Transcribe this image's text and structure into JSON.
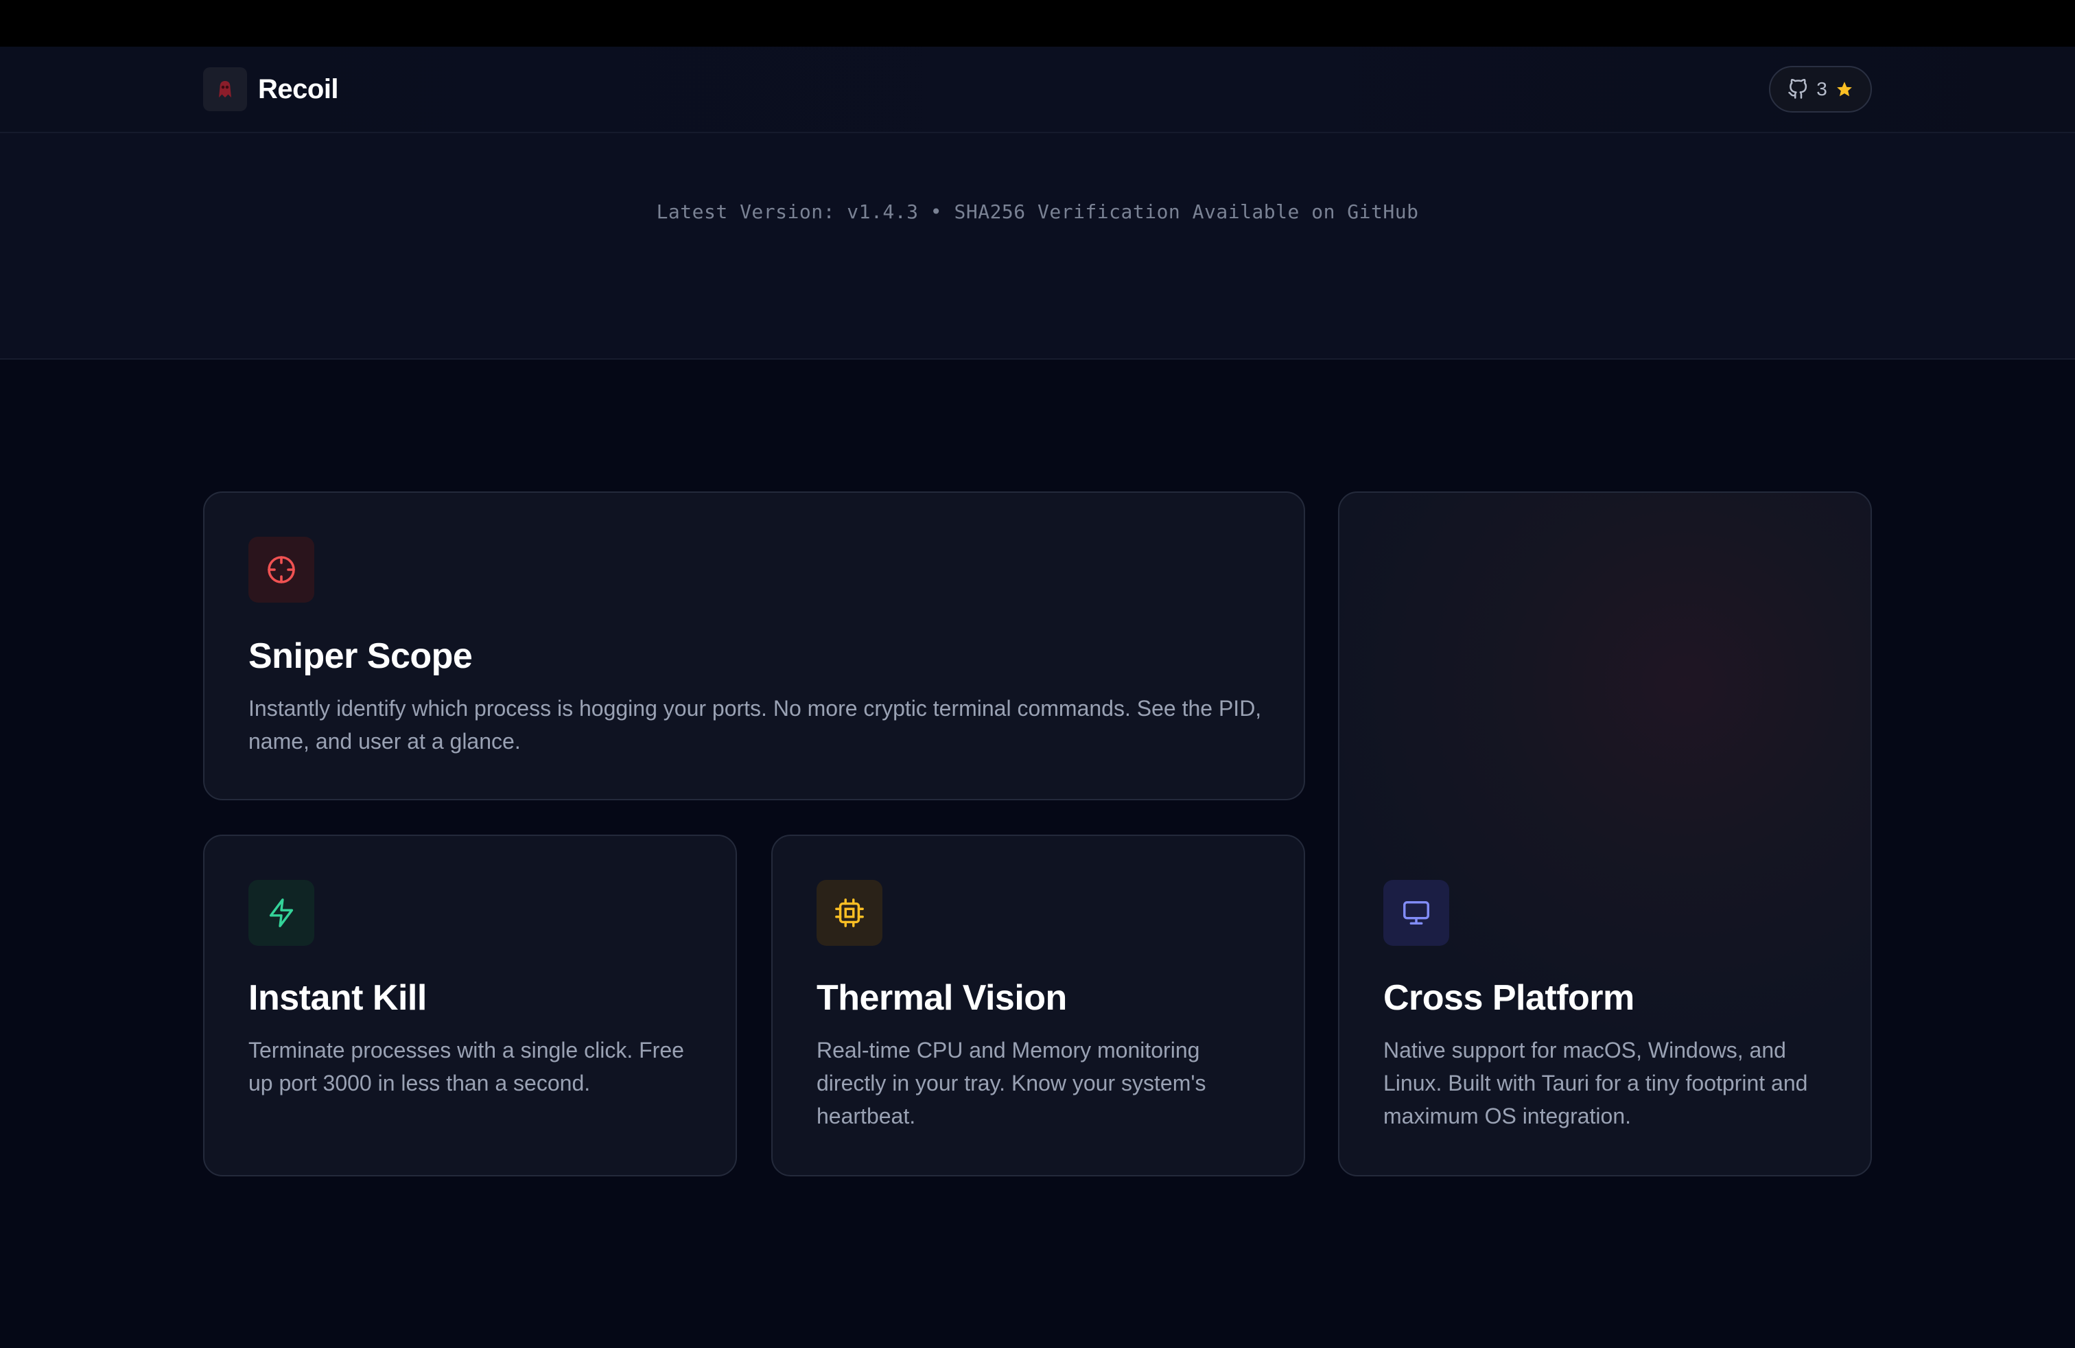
{
  "nav": {
    "brand": "Recoil",
    "github": {
      "stars": "3"
    }
  },
  "hero": {
    "version_line": "Latest Version: v1.4.3 • SHA256 Verification Available on GitHub"
  },
  "features": [
    {
      "title": "Sniper Scope",
      "desc": "Instantly identify which process is hogging your ports. No more cryptic terminal commands. See the PID, name, and user at a glance.",
      "icon": "crosshair-icon",
      "color": "#f05252"
    },
    {
      "title": "Instant Kill",
      "desc": "Terminate processes with a single click. Free up port 3000 in less than a second.",
      "icon": "lightning-icon",
      "color": "#34d399"
    },
    {
      "title": "Thermal Vision",
      "desc": "Real-time CPU and Memory monitoring directly in your tray. Know your system's heartbeat.",
      "icon": "cpu-icon",
      "color": "#fbbf24"
    },
    {
      "title": "Cross Platform",
      "desc": "Native support for macOS, Windows, and Linux. Built with Tauri for a tiny footprint and maximum OS integration.",
      "icon": "monitor-icon",
      "color": "#818cf8"
    }
  ]
}
